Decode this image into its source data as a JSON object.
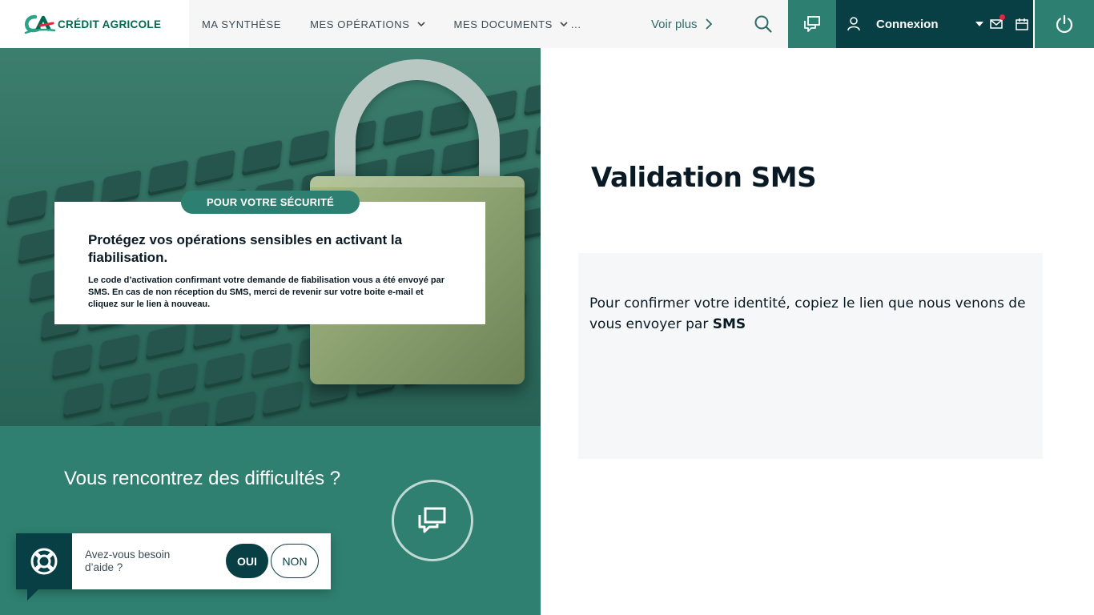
{
  "brand": {
    "logo_text": "CRÉDIT AGRICOLE",
    "primary_color": "#2d8071",
    "dark_color": "#073f45"
  },
  "nav": {
    "items": [
      {
        "label": "MA SYNTHÈSE"
      },
      {
        "label": "MES OPÉRATIONS"
      },
      {
        "label": "MES DOCUMENTS"
      }
    ],
    "ellipsis": "...",
    "voir_plus": "Voir plus"
  },
  "header": {
    "connexion_label": "Connexion"
  },
  "hero": {
    "badge": "POUR VOTRE SÉCURITÉ",
    "title": "Protégez vos opérations sensibles en activant la fiabilisation.",
    "text": "Le code d’activation confirmant  votre demande de fiabilisation vous a été envoyé par SMS. En cas de non réception du SMS, merci de revenir sur votre boite e-mail et cliquez sur le lien à nouveau."
  },
  "help": {
    "title": "Vous rencontrez des difficultés ?"
  },
  "popup": {
    "question": "Avez-vous besoin d’aide ?",
    "yes_label": "OUI",
    "no_label": "NON"
  },
  "main": {
    "title": "Validation SMS",
    "message_prefix": "Pour confirmer votre identité, copiez le lien que nous venons de vous envoyer par ",
    "message_bold": "SMS"
  }
}
